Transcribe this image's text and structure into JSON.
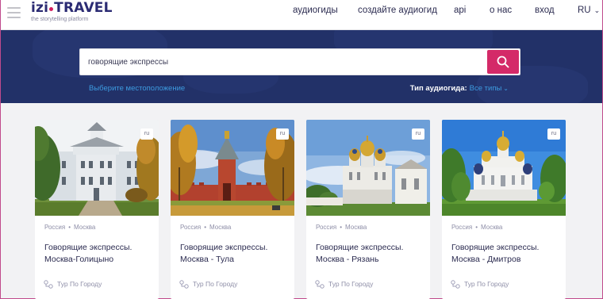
{
  "header": {
    "logo_main_left": "izi",
    "logo_main_right": "TRAVEL",
    "logo_tagline": "the storytelling platform",
    "nav": [
      {
        "label": "аудиогиды"
      },
      {
        "label": "создайте аудиогид"
      },
      {
        "label": "api"
      },
      {
        "label": "о нас"
      },
      {
        "label": "вход"
      }
    ],
    "language": "RU"
  },
  "search": {
    "query": "говорящие экспрессы",
    "location_link": "Выберите местоположение",
    "type_label": "Тип аудиогида:",
    "type_value": "Все типы"
  },
  "colors": {
    "accent": "#d42a68",
    "hero_bg": "#223168",
    "link": "#3d9be0"
  },
  "cards": [
    {
      "badge": "ru",
      "country": "Россия",
      "city": "Москва",
      "title": "Говорящие экспрессы. Москва-Голицыно",
      "category": "Тур По Городу"
    },
    {
      "badge": "ru",
      "country": "Россия",
      "city": "Москва",
      "title": "Говорящие экспрессы. Москва - Тула",
      "category": "Тур По Городу"
    },
    {
      "badge": "ru",
      "country": "Россия",
      "city": "Москва",
      "title": "Говорящие экспрессы. Москва - Рязань",
      "category": "Тур По Городу"
    },
    {
      "badge": "ru",
      "country": "Россия",
      "city": "Москва",
      "title": "Говорящие экспрессы. Москва - Дмитров",
      "category": "Тур По Городу"
    }
  ]
}
